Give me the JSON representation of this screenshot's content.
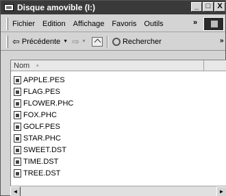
{
  "window": {
    "title": "Disque amovible (I:)",
    "buttons": [
      "_",
      "□",
      "X"
    ]
  },
  "menu": {
    "items": [
      "Fichier",
      "Edition",
      "Affichage",
      "Favoris",
      "Outils"
    ],
    "overflow": "»"
  },
  "toolbar": {
    "back_label": "Précédente",
    "search_label": "Rechercher",
    "overflow": "»"
  },
  "list": {
    "column_name": "Nom",
    "files": [
      "APPLE.PES",
      "FLAG.PES",
      "FLOWER.PHC",
      "FOX.PHC",
      "GOLF.PES",
      "STAR.PHC",
      "SWEET.DST",
      "TIME.DST",
      "TREE.DST"
    ]
  },
  "scrollbar": {
    "left_arrow": "◄",
    "right_arrow": "►"
  }
}
